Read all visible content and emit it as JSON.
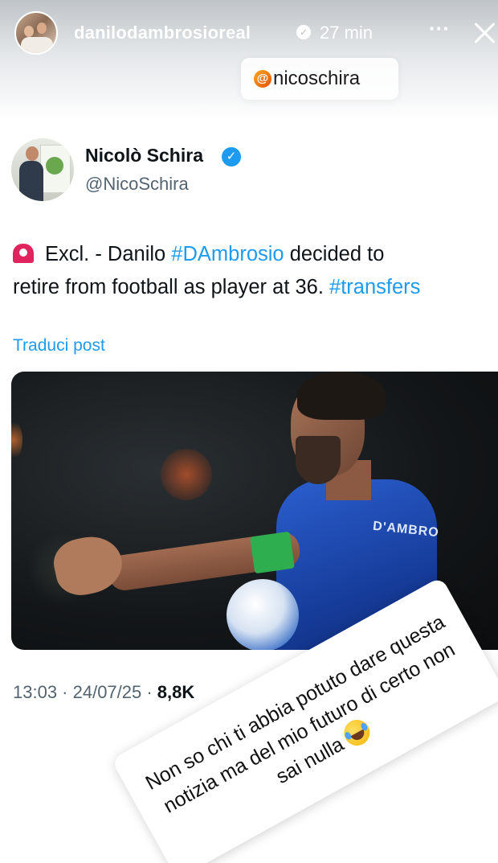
{
  "story": {
    "username": "danilodambrosioreal",
    "time": "27 min",
    "more_icon": "more-horizontal-icon",
    "close_icon": "close-icon",
    "mention": "nicoschira"
  },
  "tweet": {
    "name": "Nicolò Schira",
    "handle": "@NicoSchira",
    "body_segments": {
      "s1": "Excl. - Danilo ",
      "h1": "#DAmbrosio",
      "s2": " decided to",
      "s3": "retire from football as player at 36. ",
      "h2": "#transfers"
    },
    "translate": "Traduci post",
    "photo_jersey_text": "D'AMBRO",
    "meta_time": "13:03 · 24/07/25 · ",
    "meta_views": "8,8K"
  },
  "reply": {
    "line1": "Non so chi ti abbia potuto dare questa",
    "line2": "notizia ma del mio futuro di certo non",
    "line3": "sai nulla"
  },
  "colors": {
    "accent": "#1d9bf0",
    "text": "#0f1419",
    "muted": "#536471"
  }
}
